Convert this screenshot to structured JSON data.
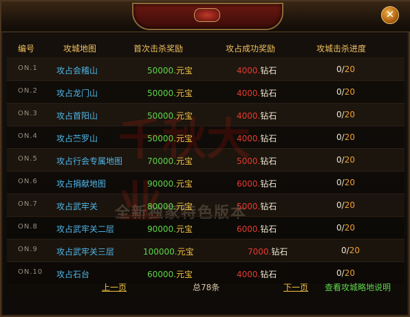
{
  "window": {
    "close_label": "✕"
  },
  "table": {
    "headers": [
      "编号",
      "攻城地图",
      "首次击杀奖励",
      "攻占成功奖励",
      "攻城击杀进度"
    ],
    "rows": [
      {
        "id": "ON.1",
        "map": "攻占会稽山",
        "kill_amount": "50000.",
        "kill_unit": "元宝",
        "succ_amount": "4000.",
        "succ_unit": "钻石",
        "prog_done": "0/",
        "prog_total": "20"
      },
      {
        "id": "ON.2",
        "map": "攻占龙门山",
        "kill_amount": "50000.",
        "kill_unit": "元宝",
        "succ_amount": "4000.",
        "succ_unit": "钻石",
        "prog_done": "0/",
        "prog_total": "20"
      },
      {
        "id": "ON.3",
        "map": "攻占首阳山",
        "kill_amount": "50000.",
        "kill_unit": "元宝",
        "succ_amount": "4000.",
        "succ_unit": "钻石",
        "prog_done": "0/",
        "prog_total": "20"
      },
      {
        "id": "ON.4",
        "map": "攻占苎罗山",
        "kill_amount": "50000.",
        "kill_unit": "元宝",
        "succ_amount": "4000.",
        "succ_unit": "钻石",
        "prog_done": "0/",
        "prog_total": "20"
      },
      {
        "id": "ON.5",
        "map": "攻占行会专属地图",
        "kill_amount": "70000.",
        "kill_unit": "元宝",
        "succ_amount": "5000.",
        "succ_unit": "钻石",
        "prog_done": "0/",
        "prog_total": "20"
      },
      {
        "id": "ON.6",
        "map": "攻占捐献地图",
        "kill_amount": "90000.",
        "kill_unit": "元宝",
        "succ_amount": "6000.",
        "succ_unit": "钻石",
        "prog_done": "0/",
        "prog_total": "20"
      },
      {
        "id": "ON.7",
        "map": "攻占武牢关",
        "kill_amount": "80000.",
        "kill_unit": "元宝",
        "succ_amount": "5000.",
        "succ_unit": "钻石",
        "prog_done": "0/",
        "prog_total": "20"
      },
      {
        "id": "ON.8",
        "map": "攻占武牢关二层",
        "kill_amount": "90000.",
        "kill_unit": "元宝",
        "succ_amount": "6000.",
        "succ_unit": "钻石",
        "prog_done": "0/",
        "prog_total": "20"
      },
      {
        "id": "ON.9",
        "map": "攻占武牢关三层",
        "kill_amount": "100000.",
        "kill_unit": "元宝",
        "succ_amount": "7000.",
        "succ_unit": "钻石",
        "prog_done": "0/",
        "prog_total": "20"
      },
      {
        "id": "ON.10",
        "map": "攻占石台",
        "kill_amount": "60000.",
        "kill_unit": "元宝",
        "succ_amount": "4000.",
        "succ_unit": "钻石",
        "prog_done": "0/",
        "prog_total": "20"
      }
    ]
  },
  "footer": {
    "prev_label": "上一页",
    "total_label": "总78条",
    "next_label": "下一页",
    "help_label": "查看攻城略地说明"
  },
  "watermark": {
    "logo_text": "千秋大业",
    "slogan": "全新独家特色版本"
  },
  "colors": {
    "header_text": "#f0c060",
    "map_text": "#4fb6e8",
    "kill_amount": "#5fd64a",
    "success_amount": "#e63a2e",
    "progress_total": "#f0a030"
  }
}
